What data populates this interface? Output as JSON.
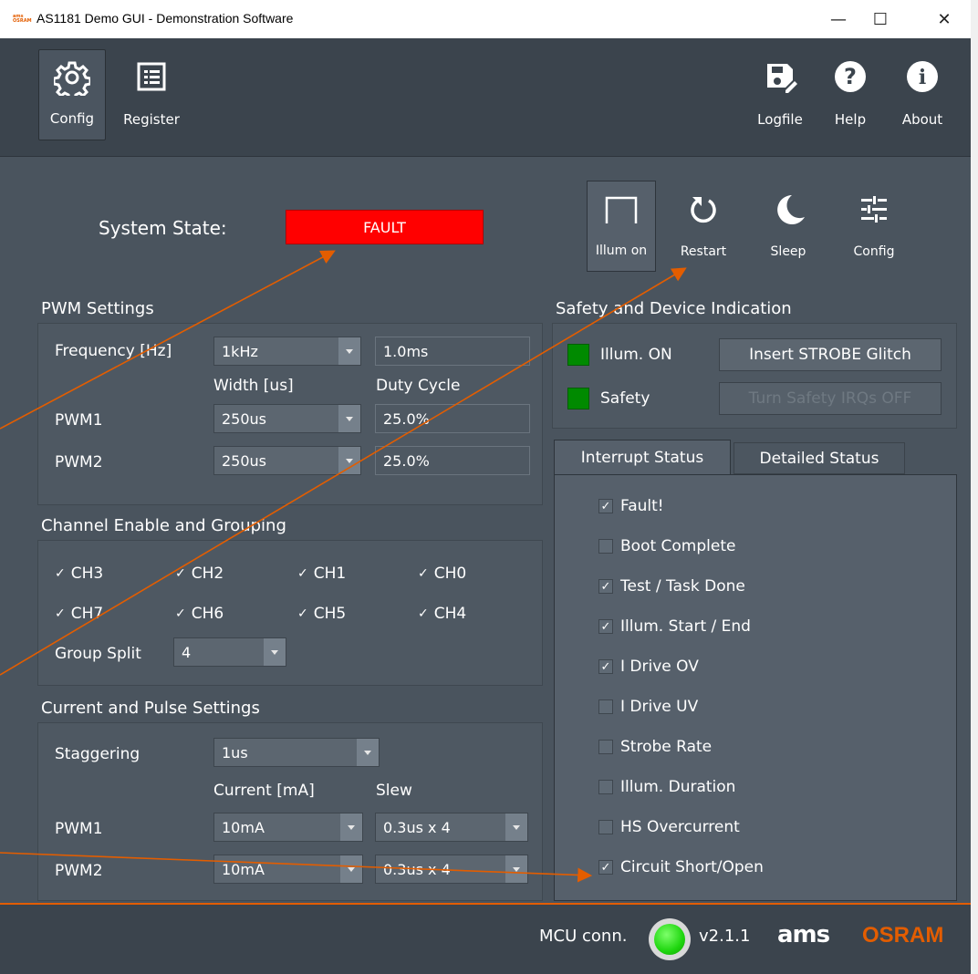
{
  "window": {
    "title": "AS1181 Demo GUI - Demonstration Software",
    "logo_text": "ams OSRAM",
    "minimize": "—",
    "maximize": "☐",
    "close": "✕"
  },
  "toolbar": {
    "config_label": "Config",
    "register_label": "Register",
    "logfile_label": "Logfile",
    "help_label": "Help",
    "about_label": "About"
  },
  "system": {
    "label": "System State:",
    "state": "FAULT",
    "state_color": "#ff0000"
  },
  "actions": {
    "illum_on": "Illum on",
    "restart": "Restart",
    "sleep": "Sleep",
    "config": "Config"
  },
  "pwm": {
    "title": "PWM Settings",
    "frequency_label": "Frequency [Hz]",
    "frequency": "1kHz",
    "period": "1.0ms",
    "width_header": "Width [us]",
    "duty_header": "Duty Cycle",
    "rows": [
      {
        "label": "PWM1",
        "width": "250us",
        "duty": "25.0%"
      },
      {
        "label": "PWM2",
        "width": "250us",
        "duty": "25.0%"
      }
    ]
  },
  "channels": {
    "title": "Channel Enable and Grouping",
    "items": [
      "CH3",
      "CH2",
      "CH1",
      "CH0",
      "CH7",
      "CH6",
      "CH5",
      "CH4"
    ],
    "checked": [
      true,
      true,
      true,
      true,
      true,
      true,
      true,
      true
    ],
    "group_split_label": "Group Split",
    "group_split": "4"
  },
  "current": {
    "title": "Current and Pulse Settings",
    "staggering_label": "Staggering",
    "staggering": "1us",
    "current_header": "Current [mA]",
    "slew_header": "Slew",
    "rows": [
      {
        "label": "PWM1",
        "current": "10mA",
        "slew": "0.3us x 4"
      },
      {
        "label": "PWM2",
        "current": "10mA",
        "slew": "0.3us x 4"
      }
    ]
  },
  "safety": {
    "title": "Safety and Device Indication",
    "illum_label": "Illum. ON",
    "safety_label": "Safety",
    "strobe_button": "Insert STROBE Glitch",
    "irq_button": "Turn Safety IRQs OFF",
    "led_color": "#008a00"
  },
  "tabs": {
    "interrupt": "Interrupt Status",
    "detailed": "Detailed Status"
  },
  "interrupts": [
    {
      "label": "Fault!",
      "checked": true
    },
    {
      "label": "Boot Complete",
      "checked": false
    },
    {
      "label": "Test / Task Done",
      "checked": true
    },
    {
      "label": "Illum. Start / End",
      "checked": true
    },
    {
      "label": "I Drive OV",
      "checked": true
    },
    {
      "label": "I Drive UV",
      "checked": false
    },
    {
      "label": "Strobe Rate",
      "checked": false
    },
    {
      "label": "Illum. Duration",
      "checked": false
    },
    {
      "label": "HS Overcurrent",
      "checked": false
    },
    {
      "label": "Circuit Short/Open",
      "checked": true
    }
  ],
  "status": {
    "mcu_label": "MCU conn.",
    "version": "v2.1.1",
    "brand_ams": "ams",
    "brand_osram": "OSRAM",
    "accent": "#e35d00"
  },
  "check_mark": "✓"
}
